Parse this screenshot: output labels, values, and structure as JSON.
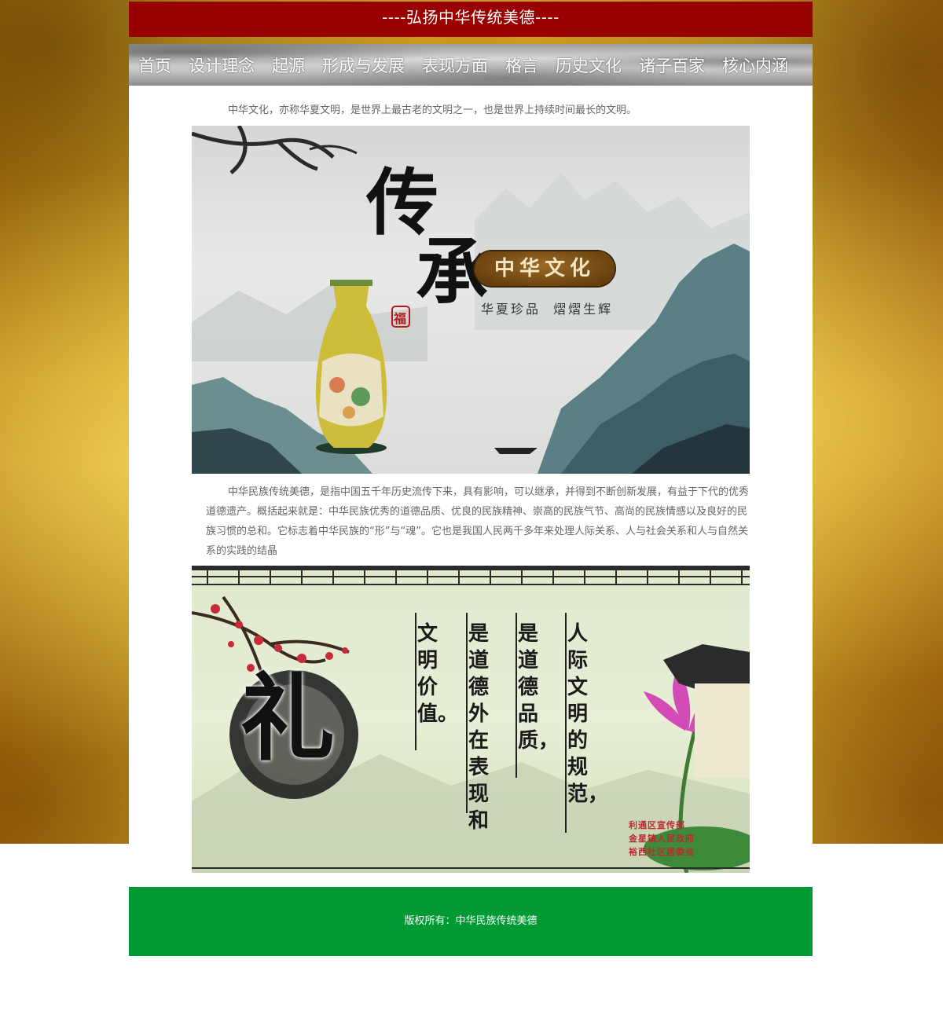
{
  "header": {
    "title": "----弘扬中华传统美德----"
  },
  "nav": {
    "items": [
      "首页",
      "设计理念",
      "起源",
      "形成与发展",
      "表现方面",
      "格言",
      "历史文化",
      "诸子百家",
      "核心内涵"
    ]
  },
  "intro": {
    "text": "中华文化，亦称华夏文明，是世界上最古老的文明之一，也是世界上持续时间最长的文明。"
  },
  "banner1": {
    "big_chars": [
      "传",
      "承"
    ],
    "badge": "中华文化",
    "subtitle": "华夏珍品  熠熠生辉",
    "seal": "福"
  },
  "body": {
    "text": "中华民族传统美德，是指中国五千年历史流传下来，具有影响，可以继承，并得到不断创新发展，有益于下代的优秀道德遗产。概括起来就是：中华民族优秀的道德品质、优良的民族精神、崇高的民族气节、高尚的民族情感以及良好的民族习惯的总和。它标志着中华民族的“形”与“魂”。它也是我国人民两千多年来处理人际关系、人与社会关系和人与自然关系的实践的结晶"
  },
  "banner2": {
    "big_char": "礼",
    "columns": [
      "人际文明的规范，",
      "是道德品质，",
      "是道德外在表现和",
      "文明价值。"
    ],
    "credits": [
      "利通区宣传部",
      "金星镇人民政府",
      "裕西社区居委会"
    ]
  },
  "footer": {
    "text": "版权所有：中华民族传统美德"
  },
  "colors": {
    "header_bg": "#990000",
    "footer_bg": "#009933",
    "text_gray": "#666666"
  }
}
